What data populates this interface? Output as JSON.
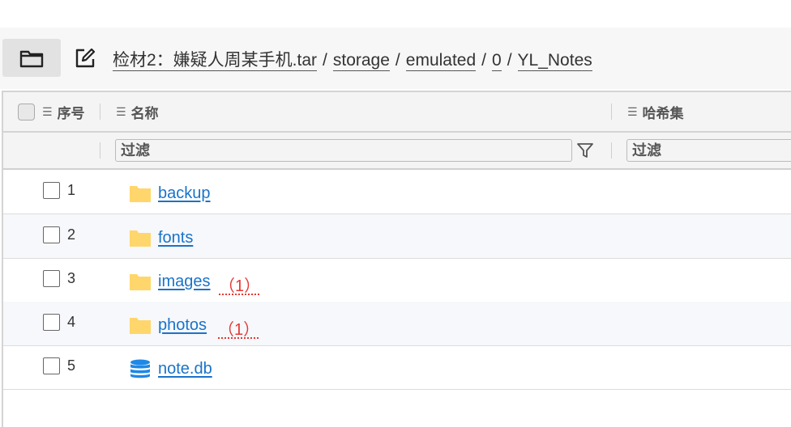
{
  "pathbar": {
    "breadcrumbs": [
      "检材2：嫌疑人周某手机.tar",
      "storage",
      "emulated",
      "0",
      "YL_Notes"
    ],
    "separator": "/"
  },
  "table": {
    "columns": {
      "index": "序号",
      "name": "名称",
      "hash": "哈希集"
    },
    "filter_placeholder": "过滤",
    "rows": [
      {
        "index": "1",
        "name": "backup",
        "type": "folder",
        "count": ""
      },
      {
        "index": "2",
        "name": "fonts",
        "type": "folder",
        "count": ""
      },
      {
        "index": "3",
        "name": "images",
        "type": "folder",
        "count": "（1）"
      },
      {
        "index": "4",
        "name": "photos",
        "type": "folder",
        "count": "（1）"
      },
      {
        "index": "5",
        "name": "note.db",
        "type": "database",
        "count": ""
      }
    ]
  },
  "colors": {
    "link": "#1a73c8",
    "count": "#e53935",
    "folder": "#ffd66b",
    "database": "#1e88e5"
  }
}
